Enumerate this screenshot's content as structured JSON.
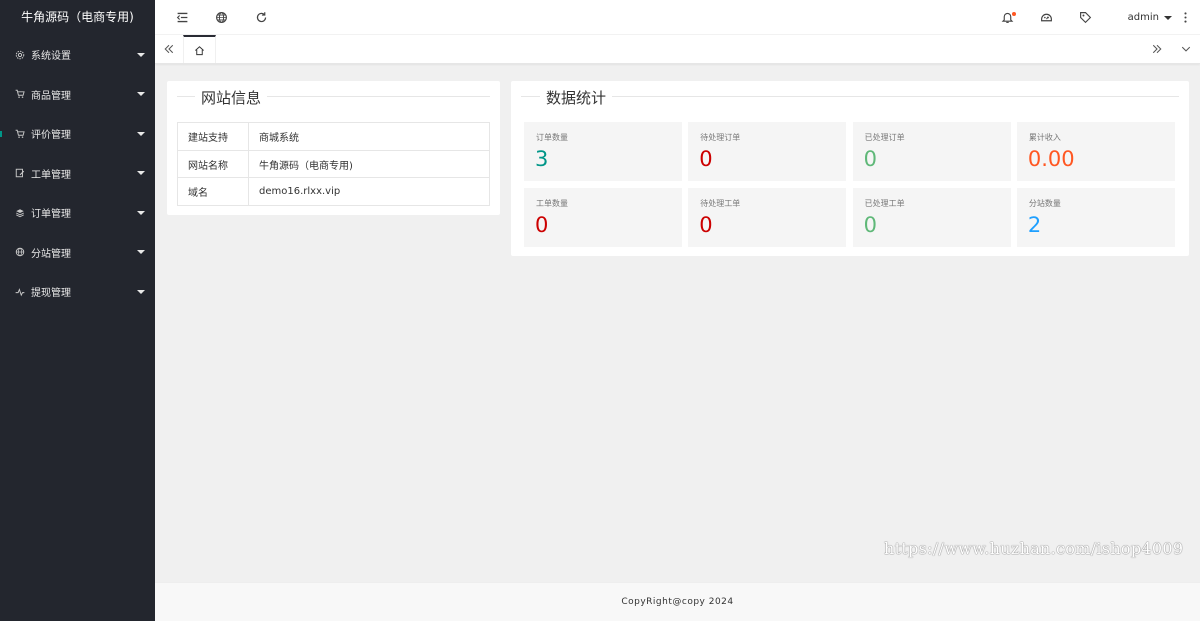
{
  "app": {
    "title": "牛角源码（电商专用)"
  },
  "sidebar": {
    "items": [
      {
        "label": "系统设置",
        "icon": "gear-icon"
      },
      {
        "label": "商品管理",
        "icon": "cart-icon"
      },
      {
        "label": "评价管理",
        "icon": "cart-icon"
      },
      {
        "label": "工单管理",
        "icon": "edit-icon"
      },
      {
        "label": "订单管理",
        "icon": "layers-icon"
      },
      {
        "label": "分站管理",
        "icon": "globe-icon"
      },
      {
        "label": "提现管理",
        "icon": "pulse-icon"
      }
    ]
  },
  "topbar": {
    "user": "admin",
    "icons": [
      "menu-collapse-icon",
      "globe-icon",
      "refresh-icon",
      "bell-icon",
      "theme-icon",
      "tag-icon",
      "more-vertical-icon"
    ]
  },
  "site_info": {
    "title": "网站信息",
    "rows": [
      {
        "key": "建站支持",
        "value": "商城系统"
      },
      {
        "key": "网站名称",
        "value": "牛角源码（电商专用)"
      },
      {
        "key": "域名",
        "value": "demo16.rlxx.vip"
      }
    ]
  },
  "stats": {
    "title": "数据统计",
    "items": [
      {
        "label": "订单数量",
        "value": "3",
        "color": "#009688"
      },
      {
        "label": "待处理订单",
        "value": "0",
        "color": "#cc0000"
      },
      {
        "label": "已处理订单",
        "value": "0",
        "color": "#5fb878"
      },
      {
        "label": "累计收入",
        "value": "0.00",
        "color": "#ff5722"
      },
      {
        "label": "工单数量",
        "value": "0",
        "color": "#cc0000"
      },
      {
        "label": "待处理工单",
        "value": "0",
        "color": "#cc0000"
      },
      {
        "label": "已处理工单",
        "value": "0",
        "color": "#5fb878"
      },
      {
        "label": "分站数量",
        "value": "2",
        "color": "#1e9fff"
      }
    ]
  },
  "watermark": "https://www.huzhan.com/ishop4009",
  "footer": {
    "text": "CopyRight@copy 2024"
  },
  "colors": {
    "sidebar_bg": "#23262e",
    "accent": "#009688",
    "notify_dot": "#ff5722"
  }
}
